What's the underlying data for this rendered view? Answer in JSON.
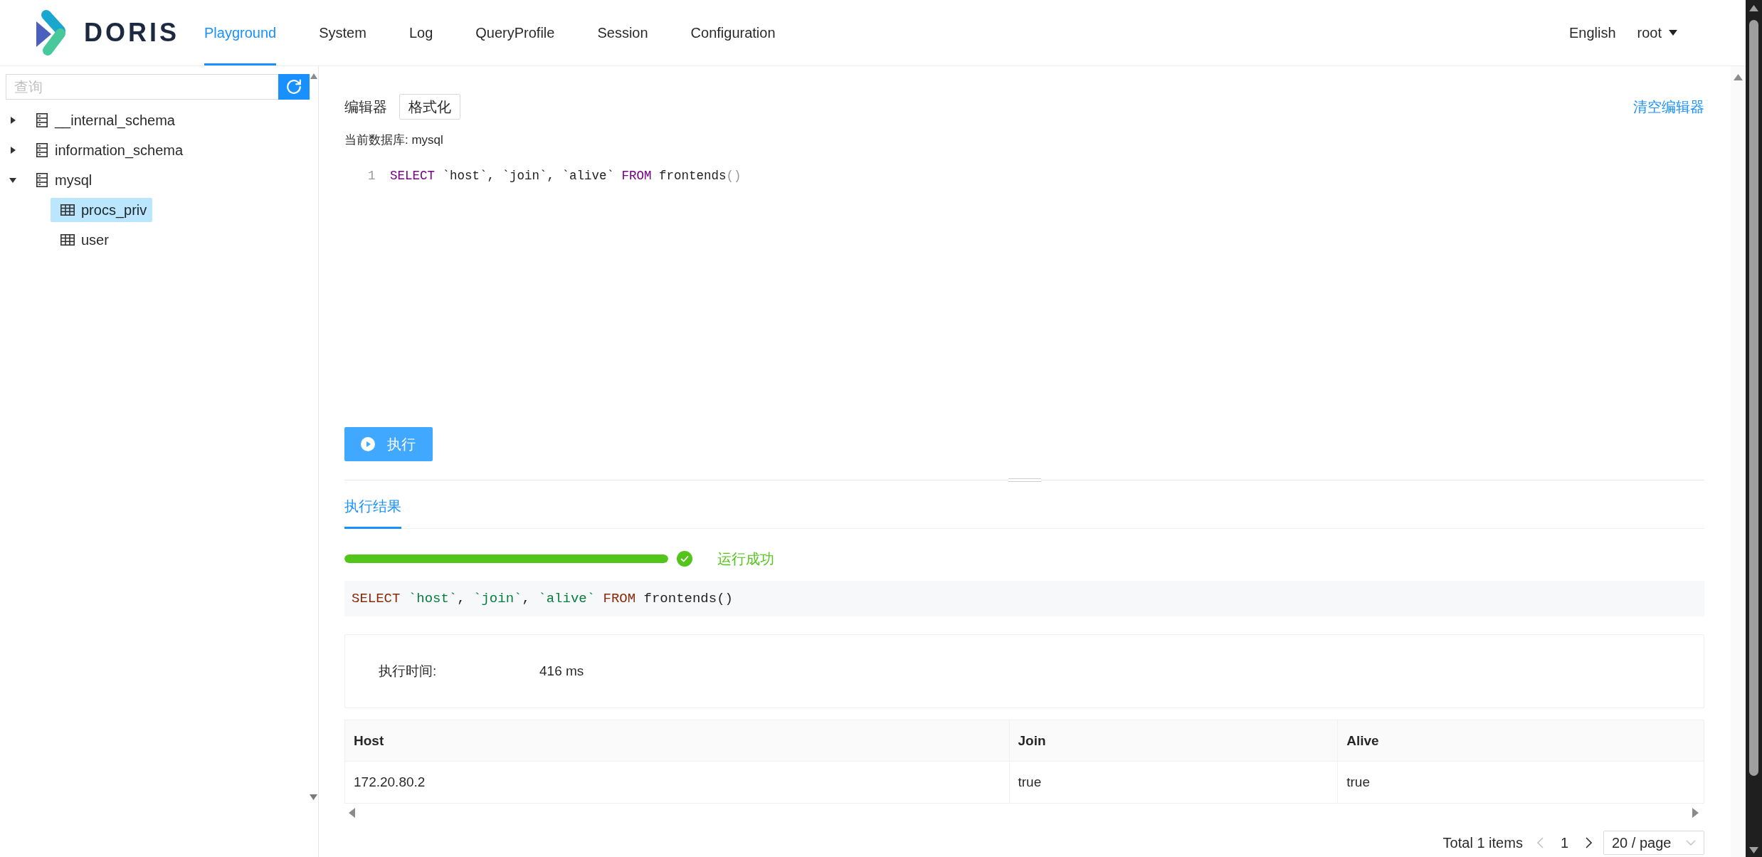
{
  "header": {
    "logo": "DORIS",
    "nav": [
      {
        "label": "Playground",
        "selected": true
      },
      {
        "label": "System",
        "selected": false
      },
      {
        "label": "Log",
        "selected": false
      },
      {
        "label": "QueryProfile",
        "selected": false
      },
      {
        "label": "Session",
        "selected": false
      },
      {
        "label": "Configuration",
        "selected": false
      }
    ],
    "language": "English",
    "user": "root"
  },
  "sidebar": {
    "search": {
      "placeholder": "查询"
    },
    "tree": [
      {
        "label": "__internal_schema",
        "kind": "database",
        "expanded": false,
        "selected": false
      },
      {
        "label": "information_schema",
        "kind": "database",
        "expanded": false,
        "selected": false
      },
      {
        "label": "mysql",
        "kind": "database",
        "expanded": true,
        "selected": false,
        "children": [
          {
            "label": "procs_priv",
            "kind": "table",
            "selected": true
          },
          {
            "label": "user",
            "kind": "table",
            "selected": false
          }
        ]
      }
    ]
  },
  "editor": {
    "title": "编辑器",
    "format_button": "格式化",
    "clear_link": "清空编辑器",
    "current_database": "当前数据库: mysql",
    "lines": [
      {
        "number": "1",
        "tokens": [
          {
            "text": "SELECT",
            "kind": "keyword"
          },
          {
            "text": " `host`, `join`, `alive` ",
            "kind": "plain"
          },
          {
            "text": "FROM",
            "kind": "keyword"
          },
          {
            "text": " frontends",
            "kind": "plain"
          },
          {
            "text": "()",
            "kind": "bracket"
          }
        ]
      }
    ],
    "run_button": "执行"
  },
  "results": {
    "tabs": [
      {
        "label": "执行结果",
        "selected": true
      }
    ],
    "progress": {
      "level": 1,
      "kind": "success",
      "status": "运行成功"
    },
    "query": [
      {
        "text": "SELECT ",
        "kind": "keyword"
      },
      {
        "text": "`host`",
        "kind": "string"
      },
      {
        "text": ", ",
        "kind": "plain"
      },
      {
        "text": "`join`",
        "kind": "string"
      },
      {
        "text": ", ",
        "kind": "plain"
      },
      {
        "text": "`alive`",
        "kind": "string"
      },
      {
        "text": " FROM",
        "kind": "keyword"
      },
      {
        "text": " frontends()",
        "kind": "plain"
      }
    ],
    "stats": [
      {
        "label": "执行时间:",
        "value": "416 ms"
      }
    ],
    "table": {
      "columns": [
        "Host",
        "Join",
        "Alive"
      ],
      "rows": [
        [
          "172.20.80.2",
          "true",
          "true"
        ]
      ]
    },
    "pagination": {
      "total": "Total 1 items",
      "previous_disabled": true,
      "current_page": "1",
      "next_disabled": false,
      "page_size": "20 / page"
    }
  }
}
